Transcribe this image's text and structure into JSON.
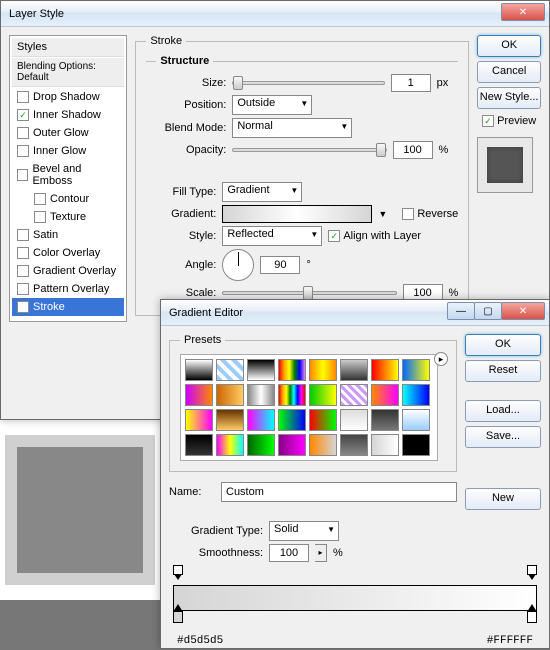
{
  "layerStyle": {
    "title": "Layer Style",
    "stylesHeader": "Styles",
    "blendingHeader": "Blending Options: Default",
    "items": [
      {
        "label": "Drop Shadow",
        "checked": false
      },
      {
        "label": "Inner Shadow",
        "checked": true
      },
      {
        "label": "Outer Glow",
        "checked": false
      },
      {
        "label": "Inner Glow",
        "checked": false
      },
      {
        "label": "Bevel and Emboss",
        "checked": false
      },
      {
        "label": "Contour",
        "checked": false,
        "indent": true
      },
      {
        "label": "Texture",
        "checked": false,
        "indent": true
      },
      {
        "label": "Satin",
        "checked": false
      },
      {
        "label": "Color Overlay",
        "checked": false
      },
      {
        "label": "Gradient Overlay",
        "checked": false
      },
      {
        "label": "Pattern Overlay",
        "checked": false
      },
      {
        "label": "Stroke",
        "checked": true,
        "selected": true
      }
    ],
    "buttons": {
      "ok": "OK",
      "cancel": "Cancel",
      "newStyle": "New Style...",
      "preview": "Preview"
    },
    "stroke": {
      "sectionTitle": "Stroke",
      "structureTitle": "Structure",
      "sizeLabel": "Size:",
      "sizeValue": "1",
      "sizeUnit": "px",
      "positionLabel": "Position:",
      "positionValue": "Outside",
      "blendLabel": "Blend Mode:",
      "blendValue": "Normal",
      "opacityLabel": "Opacity:",
      "opacityValue": "100",
      "opacityUnit": "%",
      "fillTypeLabel": "Fill Type:",
      "fillTypeValue": "Gradient",
      "gradientLabel": "Gradient:",
      "reverseLabel": "Reverse",
      "styleLabel": "Style:",
      "styleValue": "Reflected",
      "alignLabel": "Align with Layer",
      "angleLabel": "Angle:",
      "angleValue": "90",
      "angleUnit": "°",
      "scaleLabel": "Scale:",
      "scaleValue": "100",
      "scaleUnit": "%"
    }
  },
  "gradientEditor": {
    "title": "Gradient Editor",
    "presetsTitle": "Presets",
    "presets": [
      "linear-gradient(#fff,#000)",
      "repeating-linear-gradient(45deg,#9cf,#9cf 4px,#fff 4px,#fff 8px)",
      "linear-gradient(#000,#fff)",
      "linear-gradient(90deg,red,orange,yellow,green,blue,violet)",
      "linear-gradient(90deg,#f80,#ff0,#f80)",
      "linear-gradient(#ccc,#333)",
      "linear-gradient(90deg,red,#ff0)",
      "linear-gradient(90deg,#06f,#ff0)",
      "linear-gradient(90deg,#c0f,#f80)",
      "linear-gradient(90deg,#c60,#fc6)",
      "linear-gradient(90deg,#888,#fff,#888)",
      "linear-gradient(90deg,red,orange,yellow,green,cyan,blue,magenta,red)",
      "linear-gradient(90deg,#0c0,#ff0)",
      "repeating-linear-gradient(45deg,#c9f,#c9f 3px,#fff 3px,#fff 6px)",
      "linear-gradient(90deg,#f80,#f0f)",
      "linear-gradient(90deg,#0ff,#00f)",
      "linear-gradient(90deg,#ff0,#f0f)",
      "linear-gradient(#630,#fc6)",
      "linear-gradient(90deg,#f0f,#0ff)",
      "linear-gradient(90deg,#0f0,#00f)",
      "linear-gradient(90deg,#f00,#0f0)",
      "linear-gradient(#ddd,#fff)",
      "linear-gradient(#333,#777)",
      "linear-gradient(#fff,#9cf)",
      "linear-gradient(#000,#333)",
      "linear-gradient(90deg,#f0f,#ff0,#0ff)",
      "linear-gradient(90deg,#060,#0f0)",
      "linear-gradient(90deg,#808,#f0f)",
      "linear-gradient(90deg,#f80,#d5d5d5)",
      "linear-gradient(#444,#888)",
      "linear-gradient(90deg,#d5d5d5,#fff)",
      "#000"
    ],
    "buttons": {
      "ok": "OK",
      "reset": "Reset",
      "load": "Load...",
      "save": "Save...",
      "new": "New"
    },
    "nameLabel": "Name:",
    "nameValue": "Custom",
    "typeLabel": "Gradient Type:",
    "typeValue": "Solid",
    "smoothLabel": "Smoothness:",
    "smoothValue": "100",
    "smoothUnit": "%",
    "stopLeft": "#d5d5d5",
    "stopRight": "#FFFFFF"
  }
}
